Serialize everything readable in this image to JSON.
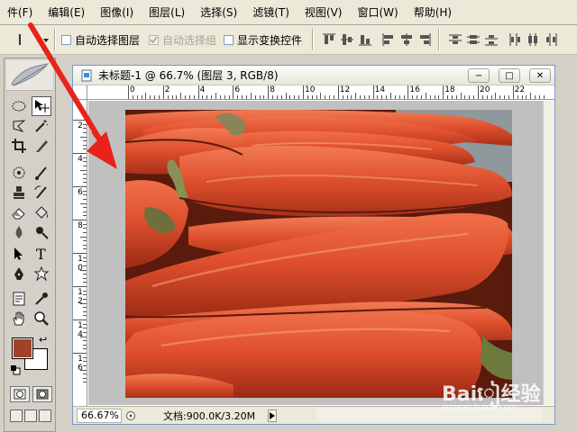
{
  "menu": [
    "件(F)",
    "编辑(E)",
    "图像(I)",
    "图层(L)",
    "选择(S)",
    "滤镜(T)",
    "视图(V)",
    "窗口(W)",
    "帮助(H)"
  ],
  "options": {
    "auto_select_layer": "自动选择图层",
    "auto_select_group": "自动选择组",
    "show_transform": "显示变换控件"
  },
  "document": {
    "title": "未标题-1 @ 66.7% (图层 3, RGB/8)",
    "zoom": "66.67%",
    "status": "文档:900.0K/3.20M"
  },
  "ruler": {
    "h_labels": [
      "0",
      "2",
      "4",
      "6",
      "8",
      "10",
      "12",
      "14",
      "16",
      "18",
      "20",
      "22"
    ],
    "v_labels": [
      "2",
      "4",
      "6",
      "8",
      "10",
      "12",
      "14",
      "16"
    ]
  },
  "window_controls": {
    "minimize": "−",
    "maximize": "□",
    "close": "✕"
  },
  "toolbox": {
    "swap": "↩"
  },
  "colors": {
    "foreground": "#a0412a",
    "background": "#ffffff",
    "arrow": "#e8231a"
  },
  "watermark": {
    "brand": "Baiៀ经验",
    "url": "jingyan.baidu.com"
  }
}
